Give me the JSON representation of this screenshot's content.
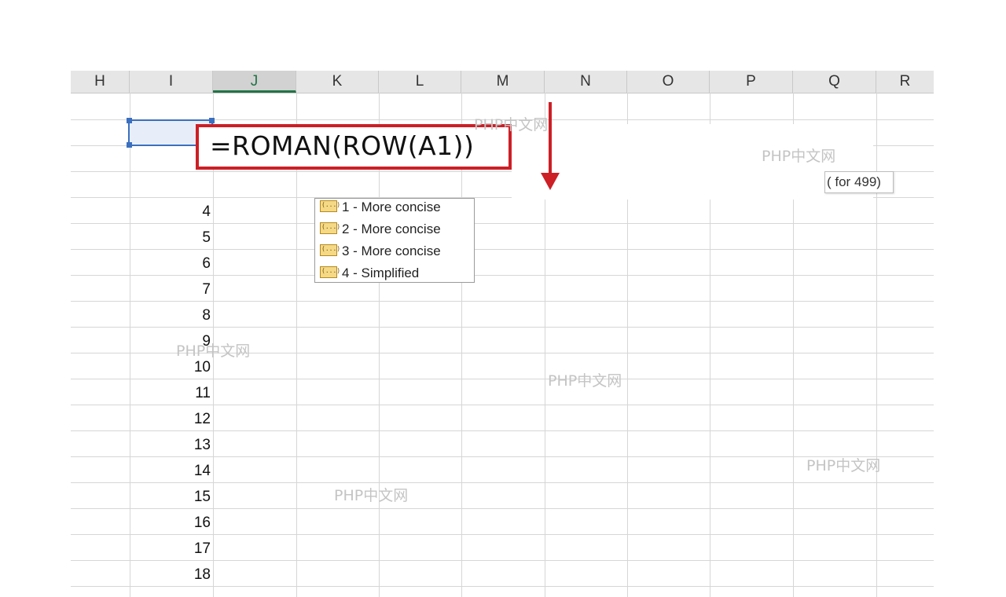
{
  "columns": [
    "H",
    "I",
    "J",
    "K",
    "L",
    "M",
    "N",
    "O",
    "P",
    "Q",
    "R"
  ],
  "active_column": "J",
  "row_values": [
    "4",
    "5",
    "6",
    "7",
    "8",
    "9",
    "10",
    "11",
    "12",
    "13",
    "14",
    "15",
    "16",
    "17",
    "18"
  ],
  "formula": {
    "text": "=ROMAN(ROW(A1))"
  },
  "tooltip": {
    "text": "( for 499)"
  },
  "autocomplete": {
    "items": [
      {
        "label": "1 - More concise",
        "icon": "function-arg-icon"
      },
      {
        "label": "2 - More concise",
        "icon": "function-arg-icon"
      },
      {
        "label": "3 - More concise",
        "icon": "function-arg-icon"
      },
      {
        "label": "4 - Simplified",
        "icon": "function-arg-icon"
      }
    ]
  },
  "watermark": {
    "text": "PHP中文网"
  },
  "colors": {
    "accent_red": "#cc1f26",
    "selection_blue": "#3b6fbf",
    "excel_green": "#217346"
  }
}
